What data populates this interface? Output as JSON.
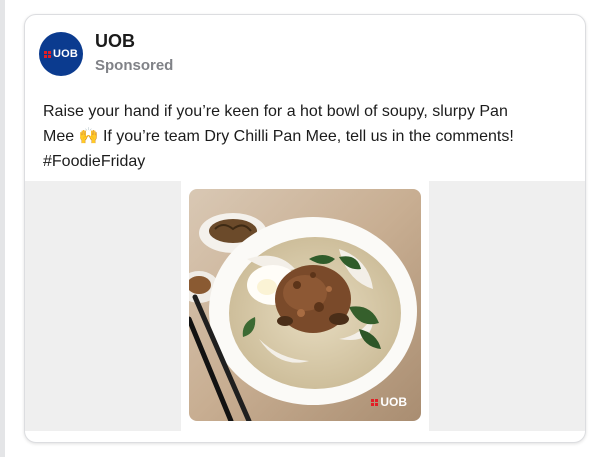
{
  "post": {
    "author": "UOB",
    "subtitle": "Sponsored",
    "avatar_text": "UOB",
    "body_line1": "Raise your hand if you’re keen for a hot bowl of soupy, slurpy Pan",
    "body_line2": "Mee 🙌 If you’re team Dry Chilli Pan Mee, tell us in the comments!",
    "body_line3": "#FoodieFriday",
    "image_watermark": "UOB"
  },
  "colors": {
    "brand_blue": "#0b3b8f",
    "brand_red": "#e21f26",
    "sponsored_gray": "#808287"
  },
  "icons": {
    "avatar": "uob-logo-icon",
    "watermark": "uob-logo-icon"
  }
}
